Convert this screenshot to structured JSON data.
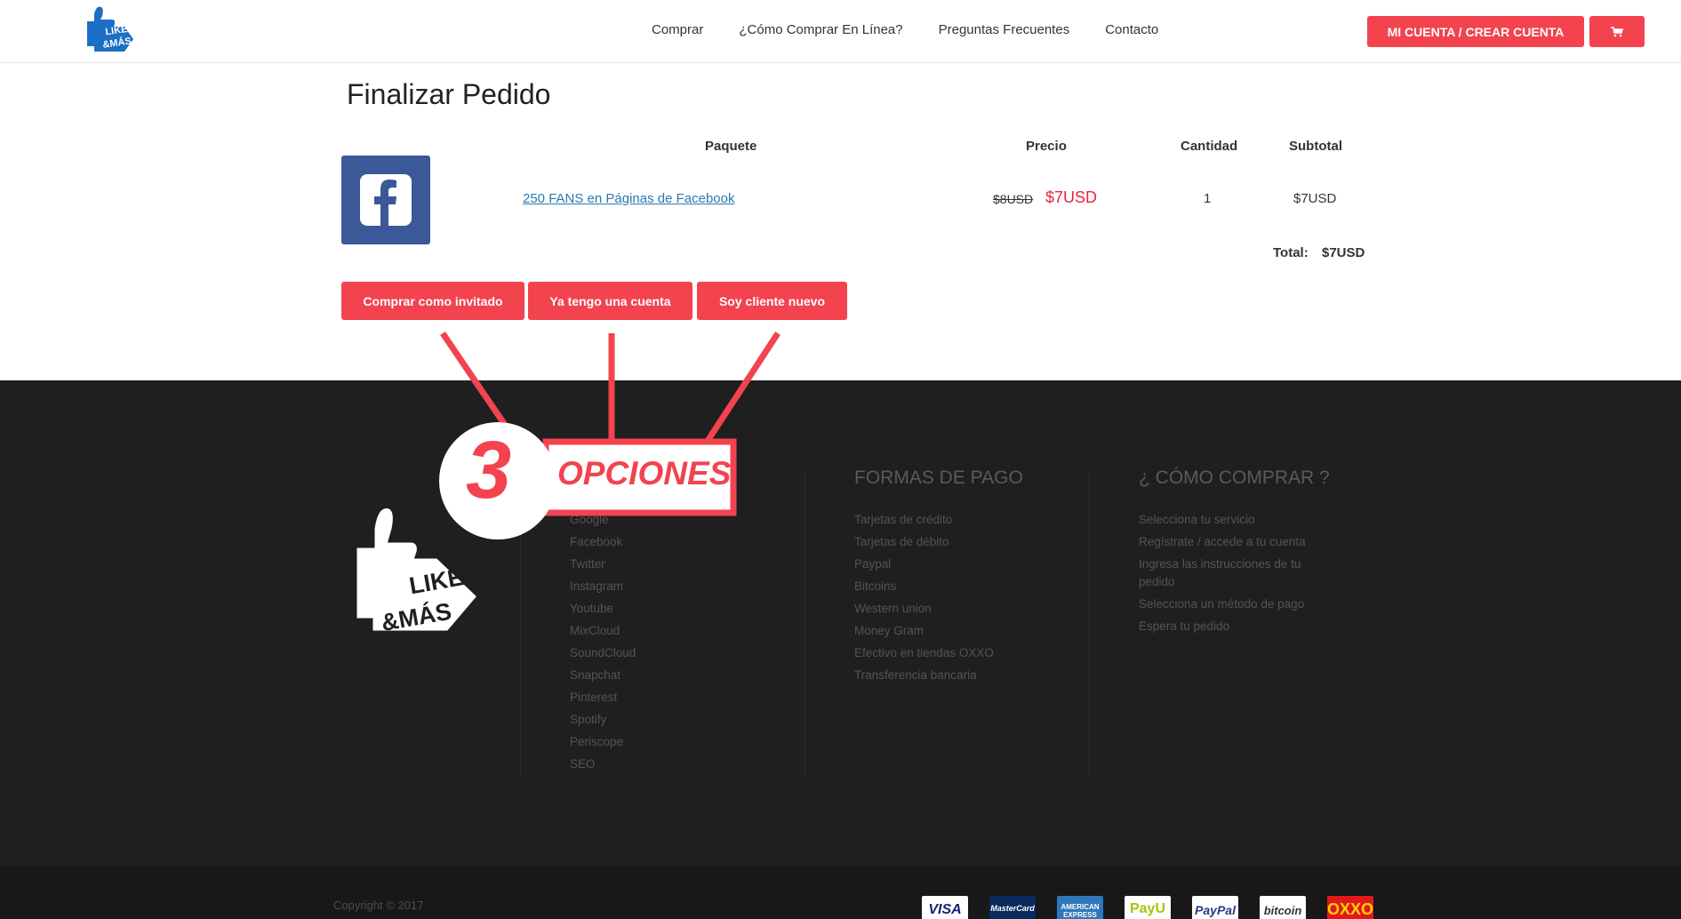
{
  "header": {
    "logo_text_line1": "LIKES",
    "logo_text_line2": "&MÁS",
    "nav": [
      "Comprar",
      "¿Cómo Comprar En Línea?",
      "Preguntas Frecuentes",
      "Contacto"
    ],
    "account_button": "MI CUENTA / CREAR CUENTA",
    "cart_icon": "shopping-cart-icon"
  },
  "checkout": {
    "title": "Finalizar Pedido",
    "columns": {
      "package": "Paquete",
      "price": "Precio",
      "quantity": "Cantidad",
      "subtotal": "Subtotal"
    },
    "item": {
      "icon": "facebook-icon",
      "name": "250 FANS en Páginas de Facebook",
      "old_price": "$8USD",
      "price": "$7USD",
      "quantity": "1",
      "subtotal": "$7USD"
    },
    "total_label": "Total:",
    "total_value": "$7USD",
    "options": [
      "Comprar como invitado",
      "Ya tengo una cuenta",
      "Soy cliente nuevo"
    ]
  },
  "annotation": {
    "number": "3",
    "label": "OPCIONES",
    "color": "#f2434f"
  },
  "footer": {
    "services": [
      "Google",
      "Facebook",
      "Twitter",
      "Instagram",
      "Youtube",
      "MixCloud",
      "SoundCloud",
      "Snapchat",
      "Pinterest",
      "Spotify",
      "Periscope",
      "SEO"
    ],
    "payment_title": "FORMAS DE PAGO",
    "payment_methods": [
      "Tarjetas de crédito",
      "Tarjetas de débito",
      "Paypal",
      "Bitcoins",
      "Western union",
      "Money Gram",
      "Efectivo en tiendas OXXO",
      "Transferencia bancaria"
    ],
    "howto_title": "¿ CÓMO COMPRAR ?",
    "howto_steps": [
      "Selecciona tu servicio",
      "Regístrate / accede a tu cuenta",
      "Ingresa las instrucciones de tu pedido",
      "Selecciona un método de pago",
      "Espera tu pedido"
    ],
    "copyright": "Copyright © 2017",
    "payment_logos": [
      "VISA",
      "MasterCard",
      "AMERICAN EXPRESS",
      "PayU",
      "PayPal",
      "bitcoin",
      "OXXO"
    ]
  },
  "colors": {
    "accent": "#f2434f",
    "link": "#2a7ab0",
    "footer_bg": "#1f1f1f",
    "facebook": "#3b5998",
    "sale_price": "#e8243f"
  }
}
